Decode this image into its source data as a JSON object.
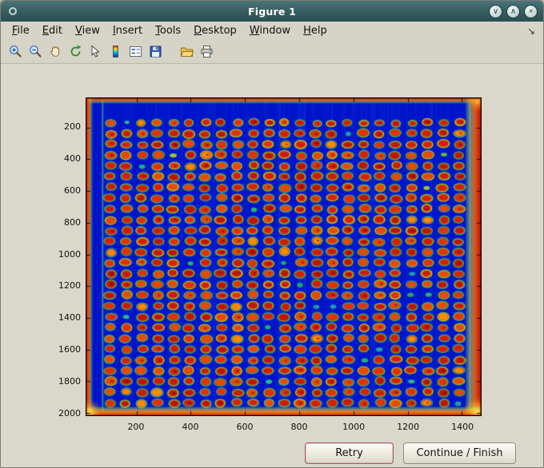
{
  "window": {
    "title": "Figure 1",
    "titlebar_color": "#345a5d",
    "controls": [
      {
        "name": "shade",
        "glyph": "∨"
      },
      {
        "name": "maximize",
        "glyph": "∧"
      },
      {
        "name": "close",
        "glyph": "×"
      }
    ]
  },
  "menu": {
    "items": [
      {
        "label": "File"
      },
      {
        "label": "Edit"
      },
      {
        "label": "View"
      },
      {
        "label": "Insert"
      },
      {
        "label": "Tools"
      },
      {
        "label": "Desktop"
      },
      {
        "label": "Window"
      },
      {
        "label": "Help"
      }
    ],
    "dock_icon": "↘"
  },
  "toolbar": {
    "buttons": [
      "zoom-in",
      "zoom-out",
      "pan",
      "rotate-3d",
      "edit-plot",
      "insert-colorbar",
      "insert-legend",
      "save-figure",
      "open-file",
      "print-figure"
    ]
  },
  "chart_data": {
    "type": "heatmap",
    "title": "",
    "xlabel": "",
    "ylabel": "",
    "description": "Pseudocolor (jet colormap) image of a scanned spotted plate/microarray: a regular grid of red-orange spots with green halos on a deep blue background, saturated red-orange bands along all four image borders, shown in a MATLAB Figure 1 window with Retry and Continue/Finish buttons.",
    "x_ticks": [
      200,
      400,
      600,
      800,
      1000,
      1200,
      1400
    ],
    "y_ticks": [
      200,
      400,
      600,
      800,
      1000,
      1200,
      1400,
      1600,
      1800,
      2000
    ],
    "x_range": [
      15,
      1470
    ],
    "y_range": [
      15,
      2015
    ],
    "spot_grid": {
      "cols": 23,
      "rows": 27,
      "x_start": 103,
      "x_step": 58.5,
      "y_start": 170,
      "y_step": 68
    },
    "colors": {
      "background": "#0013c8",
      "spot_core": "#d22000",
      "spot_ring": "#2ab06a",
      "edge": "#e83000",
      "edge_inner": "#ffd000"
    }
  },
  "footer": {
    "buttons": [
      {
        "label": "Retry"
      },
      {
        "label": "Continue / Finish"
      }
    ]
  }
}
